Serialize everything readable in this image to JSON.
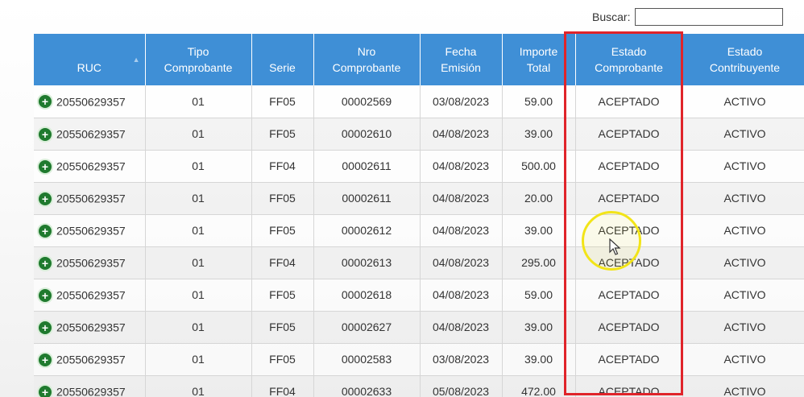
{
  "search": {
    "label": "Buscar:",
    "value": ""
  },
  "table": {
    "headers": [
      {
        "line1": "",
        "line2": "RUC"
      },
      {
        "line1": "Tipo",
        "line2": "Comprobante"
      },
      {
        "line1": "",
        "line2": "Serie"
      },
      {
        "line1": "Nro",
        "line2": "Comprobante"
      },
      {
        "line1": "Fecha",
        "line2": "Emisión"
      },
      {
        "line1": "Importe",
        "line2": "Total"
      },
      {
        "line1": "Estado",
        "line2": "Comprobante"
      },
      {
        "line1": "Estado",
        "line2": "Contribuyente"
      }
    ],
    "rows": [
      {
        "ruc": "20550629357",
        "tipo": "01",
        "serie": "FF05",
        "nro": "00002569",
        "fecha": "03/08/2023",
        "importe": "59.00",
        "estado_comp": "ACEPTADO",
        "estado_contrib": "ACTIVO"
      },
      {
        "ruc": "20550629357",
        "tipo": "01",
        "serie": "FF05",
        "nro": "00002610",
        "fecha": "04/08/2023",
        "importe": "39.00",
        "estado_comp": "ACEPTADO",
        "estado_contrib": "ACTIVO"
      },
      {
        "ruc": "20550629357",
        "tipo": "01",
        "serie": "FF04",
        "nro": "00002611",
        "fecha": "04/08/2023",
        "importe": "500.00",
        "estado_comp": "ACEPTADO",
        "estado_contrib": "ACTIVO"
      },
      {
        "ruc": "20550629357",
        "tipo": "01",
        "serie": "FF05",
        "nro": "00002611",
        "fecha": "04/08/2023",
        "importe": "20.00",
        "estado_comp": "ACEPTADO",
        "estado_contrib": "ACTIVO"
      },
      {
        "ruc": "20550629357",
        "tipo": "01",
        "serie": "FF05",
        "nro": "00002612",
        "fecha": "04/08/2023",
        "importe": "39.00",
        "estado_comp": "ACEPTADO",
        "estado_contrib": "ACTIVO"
      },
      {
        "ruc": "20550629357",
        "tipo": "01",
        "serie": "FF04",
        "nro": "00002613",
        "fecha": "04/08/2023",
        "importe": "295.00",
        "estado_comp": "ACEPTADO",
        "estado_contrib": "ACTIVO"
      },
      {
        "ruc": "20550629357",
        "tipo": "01",
        "serie": "FF05",
        "nro": "00002618",
        "fecha": "04/08/2023",
        "importe": "59.00",
        "estado_comp": "ACEPTADO",
        "estado_contrib": "ACTIVO"
      },
      {
        "ruc": "20550629357",
        "tipo": "01",
        "serie": "FF05",
        "nro": "00002627",
        "fecha": "04/08/2023",
        "importe": "39.00",
        "estado_comp": "ACEPTADO",
        "estado_contrib": "ACTIVO"
      },
      {
        "ruc": "20550629357",
        "tipo": "01",
        "serie": "FF05",
        "nro": "00002583",
        "fecha": "03/08/2023",
        "importe": "39.00",
        "estado_comp": "ACEPTADO",
        "estado_contrib": "ACTIVO"
      },
      {
        "ruc": "20550629357",
        "tipo": "01",
        "serie": "FF04",
        "nro": "00002633",
        "fecha": "05/08/2023",
        "importe": "472.00",
        "estado_comp": "ACEPTADO",
        "estado_contrib": "ACTIVO"
      }
    ]
  },
  "icons": {
    "expand": "plus-circle-icon",
    "sort": "sort-asc-icon",
    "cursor": "mouse-pointer-icon"
  },
  "colors": {
    "header_bg": "#3f8fd6",
    "highlight": "#e0242a",
    "cursor_ring": "#f2e418",
    "expand_icon": "#1f7a2e"
  }
}
